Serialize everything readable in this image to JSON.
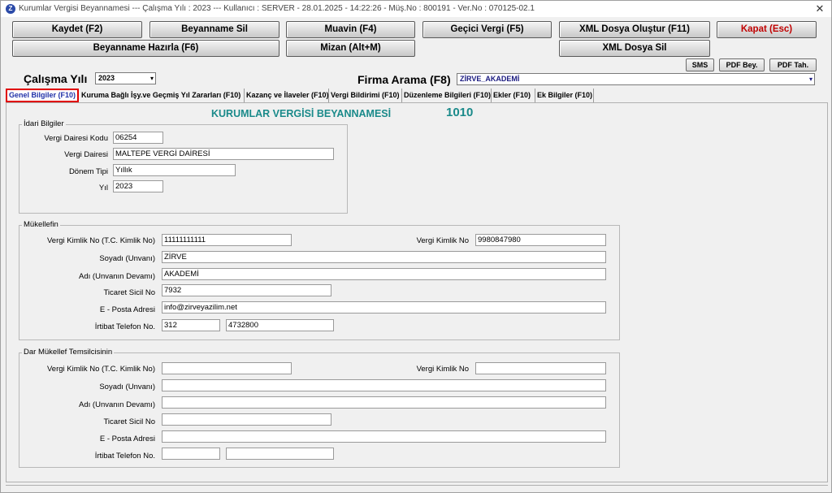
{
  "window": {
    "title": "Kurumlar Vergisi Beyannamesi  ---  Çalışma Yılı : 2023  ---  Kullanıcı : SERVER - 28.01.2025 - 14:22:26 - Müş.No : 800191 - Ver.No : 070125-02.1",
    "close_glyph": "✕"
  },
  "toolbar": {
    "kaydet": "Kaydet (F2)",
    "beyanname_sil": "Beyanname Sil",
    "muavin": "Muavin (F4)",
    "gecici_vergi": "Geçici Vergi (F5)",
    "xml_olustur": "XML Dosya Oluştur (F11)",
    "kapat": "Kapat (Esc)",
    "beyanname_hazirla": "Beyanname Hazırla (F6)",
    "mizan": "Mizan (Alt+M)",
    "xml_sil": "XML Dosya Sil",
    "sms": "SMS",
    "pdf_bey": "PDF Bey.",
    "pdf_tah": "PDF Tah."
  },
  "filters": {
    "calisma_yili_label": "Çalışma Yılı",
    "calisma_yili_value": "2023",
    "firma_arama_label": "Firma Arama (F8)",
    "firma_value": "ZİRVE_AKADEMİ",
    "dropdown_glyph": "▾"
  },
  "tabs": [
    "Genel Bilgiler (F10)",
    "Kuruma Bağlı İşy.ve Geçmiş Yıl Zararları (F10)",
    "Kazanç ve İlaveler (F10)",
    "Vergi Bildirimi (F10)",
    "Düzenleme Bilgileri (F10)",
    "Ekler (F10)",
    "Ek Bilgiler (F10)"
  ],
  "form": {
    "title": "KURUMLAR VERGİSİ BEYANNAMESİ",
    "code": "1010"
  },
  "idari": {
    "title": "İdari Bilgiler",
    "vd_kodu_label": "Vergi Dairesi Kodu",
    "vd_kodu": "06254",
    "vd_label": "Vergi Dairesi",
    "vd": "MALTEPE VERGİ DAİRESİ",
    "donem_label": "Dönem Tipi",
    "donem": "Yıllık",
    "yil_label": "Yıl",
    "yil": "2023"
  },
  "mukellef": {
    "title": "Mükellefin",
    "tckn_label": "Vergi Kimlik No (T.C. Kimlik No)",
    "tckn": "11111111111",
    "vkn_label": "Vergi Kimlik No",
    "vkn": "9980847980",
    "soyadi_label": "Soyadı (Unvanı)",
    "soyadi": "ZİRVE",
    "adi_label": "Adı (Unvanın Devamı)",
    "adi": "AKADEMİ",
    "ticaret_label": "Ticaret Sicil No",
    "ticaret": "7932",
    "eposta_label": "E - Posta Adresi",
    "eposta": "info@zirveyazilim.net",
    "telefon_label": "İrtibat Telefon No.",
    "tel_kod": "312",
    "tel_no": "4732800"
  },
  "temsilci": {
    "title": "Dar Mükellef Temsilcisinin",
    "tckn_label": "Vergi Kimlik No (T.C. Kimlik No)",
    "tckn": "",
    "vkn_label": "Vergi Kimlik No",
    "vkn": "",
    "soyadi_label": "Soyadı (Unvanı)",
    "soyadi": "",
    "adi_label": "Adı (Unvanın Devamı)",
    "adi": "",
    "ticaret_label": "Ticaret Sicil No",
    "ticaret": "",
    "eposta_label": "E - Posta Adresi",
    "eposta": "",
    "telefon_label": "İrtibat Telefon No.",
    "tel_kod": "",
    "tel_no": ""
  }
}
